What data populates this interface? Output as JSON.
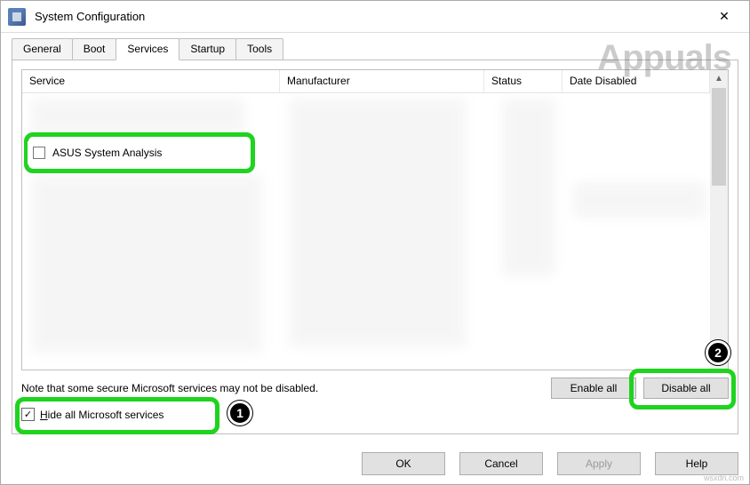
{
  "window": {
    "title": "System Configuration",
    "close_glyph": "✕"
  },
  "tabs": [
    {
      "label": "General",
      "active": false
    },
    {
      "label": "Boot",
      "active": false
    },
    {
      "label": "Services",
      "active": true
    },
    {
      "label": "Startup",
      "active": false
    },
    {
      "label": "Tools",
      "active": false
    }
  ],
  "columns": {
    "service": "Service",
    "manufacturer": "Manufacturer",
    "status": "Status",
    "date_disabled": "Date Disabled"
  },
  "visible_service": {
    "name": "ASUS System Analysis",
    "checked": false
  },
  "note": "Note that some secure Microsoft services may not be disabled.",
  "buttons": {
    "enable_all": "Enable all",
    "disable_all": "Disable all",
    "ok": "OK",
    "cancel": "Cancel",
    "apply": "Apply",
    "help": "Help"
  },
  "hide_checkbox": {
    "checked": true,
    "check_glyph": "✓",
    "label_pre": "H",
    "label_post": "ide all Microsoft services"
  },
  "annotations": {
    "badge1": "1",
    "badge2": "2"
  },
  "scroll": {
    "up": "▲",
    "down": "▼"
  },
  "watermark": "Appuals",
  "image_credit": "wsxdn.com"
}
